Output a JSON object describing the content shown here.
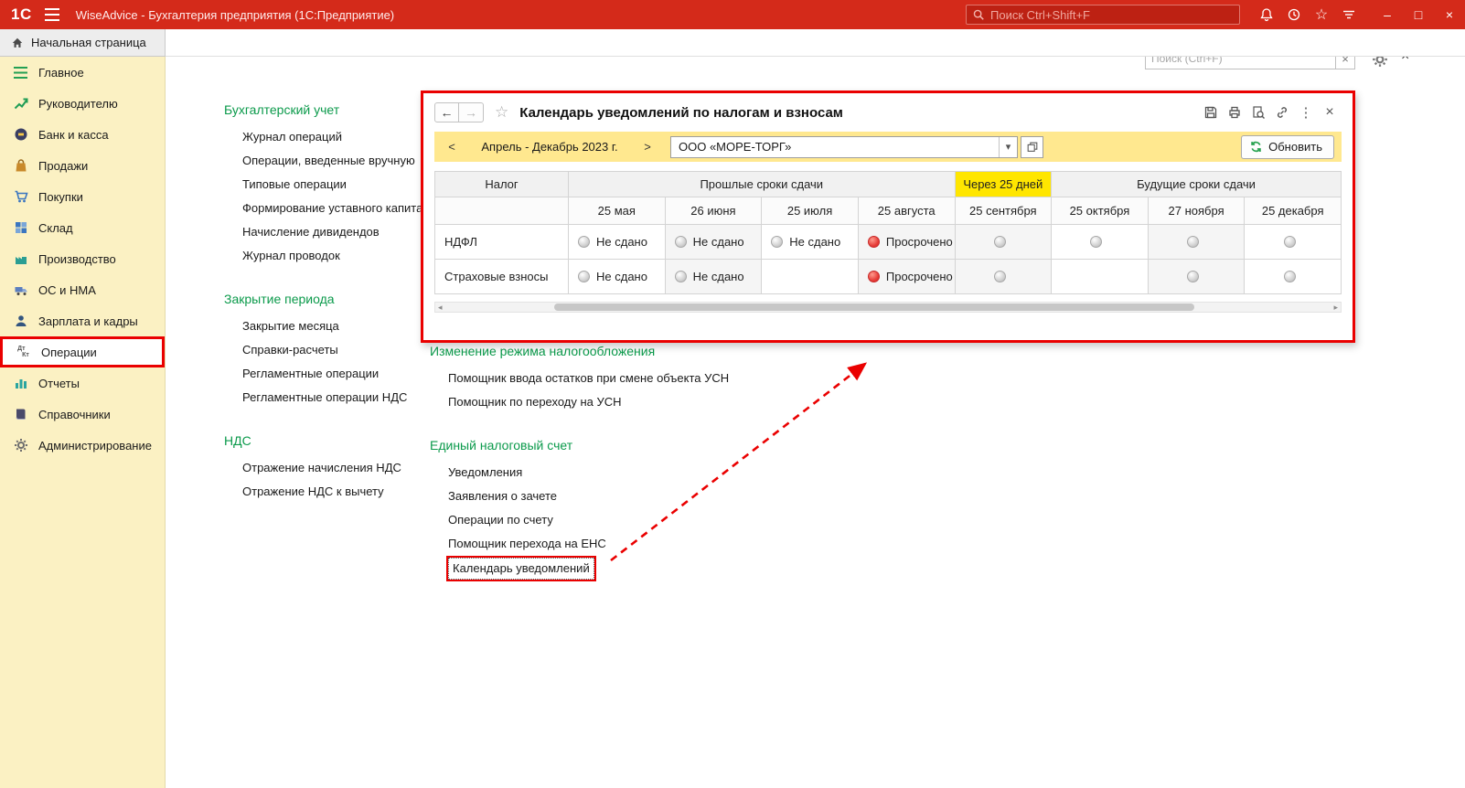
{
  "colors": {
    "brand_red": "#d42a1a",
    "sidebar_yellow": "#fbf1c3",
    "accent_green": "#0b9a4b",
    "toolbar_yellow": "#ffe88f",
    "highlight_yellow": "#ffe600",
    "overdue_red": "#e53935",
    "pending_gray": "#c4c4c4",
    "annotation_red": "#ea0000"
  },
  "icons": {
    "back": "←",
    "forward": "→",
    "star": "☆",
    "kebab": "⋮",
    "close": "×",
    "minimize": "–",
    "maximize": "□",
    "clear": "×",
    "prev": "<",
    "next": ">",
    "dropdown": "▾",
    "scroll_left": "◂",
    "scroll_right": "▸"
  },
  "titlebar": {
    "logo": "1С",
    "title": "WiseAdvice - Бухгалтерия предприятия  (1С:Предприятие)",
    "search_placeholder": "Поиск Ctrl+Shift+F"
  },
  "tabbar": {
    "home_tab": "Начальная страница"
  },
  "sidebar": {
    "items": [
      "Главное",
      "Руководителю",
      "Банк и касса",
      "Продажи",
      "Покупки",
      "Склад",
      "Производство",
      "ОС и НМА",
      "Зарплата и кадры",
      "Операции",
      "Отчеты",
      "Справочники",
      "Администрирование"
    ]
  },
  "workspace": {
    "search_placeholder": "Поиск (Ctrl+F)"
  },
  "menu": {
    "groups": [
      {
        "title": "Бухгалтерский учет",
        "items": [
          "Журнал операций",
          "Операции, введенные вручную",
          "Типовые операции",
          "Формирование уставного капитала",
          "Начисление дивидендов",
          "Журнал проводок"
        ]
      },
      {
        "title": "Закрытие периода",
        "items": [
          "Закрытие месяца",
          "Справки-расчеты",
          "Регламентные операции",
          "Регламентные операции НДС"
        ]
      },
      {
        "title": "НДС",
        "items": [
          "Отражение начисления НДС",
          "Отражение НДС к вычету"
        ]
      },
      {
        "title": "Изменение режима налогообложения",
        "items": [
          "Помощник ввода остатков при смене объекта УСН",
          "Помощник по переходу на УСН"
        ]
      },
      {
        "title": "Единый налоговый счет",
        "items": [
          "Уведомления",
          "Заявления о зачете",
          "Операции по счету",
          "Помощник перехода на ЕНС",
          "Календарь уведомлений"
        ]
      }
    ]
  },
  "window": {
    "title": "Календарь уведомлений по налогам и взносам",
    "period": "Апрель - Декабрь 2023 г.",
    "organization": "ООО «МОРЕ-ТОРГ»",
    "refresh_label": "Обновить",
    "table": {
      "tax_header": "Налог",
      "past_header": "Прошлые сроки сдачи",
      "soon_header": "Через 25 дней",
      "future_header": "Будущие сроки сдачи",
      "dates": [
        "25 мая",
        "26 июня",
        "25 июля",
        "25 августа",
        "25 сентября",
        "25 октября",
        "27 ноября",
        "25 декабря"
      ],
      "rows": [
        {
          "tax": "НДФЛ",
          "cells": [
            {
              "status": "pending",
              "label": "Не сдано"
            },
            {
              "status": "pending",
              "label": "Не сдано"
            },
            {
              "status": "pending",
              "label": "Не сдано"
            },
            {
              "status": "overdue",
              "label": "Просрочено"
            },
            {
              "status": "future",
              "label": ""
            },
            {
              "status": "future",
              "label": ""
            },
            {
              "status": "future",
              "label": ""
            },
            {
              "status": "future",
              "label": ""
            }
          ]
        },
        {
          "tax": "Страховые взносы",
          "cells": [
            {
              "status": "pending",
              "label": "Не сдано"
            },
            {
              "status": "pending",
              "label": "Не сдано"
            },
            {
              "status": "empty",
              "label": ""
            },
            {
              "status": "overdue",
              "label": "Просрочено"
            },
            {
              "status": "future",
              "label": ""
            },
            {
              "status": "empty",
              "label": ""
            },
            {
              "status": "future",
              "label": ""
            },
            {
              "status": "future",
              "label": ""
            }
          ]
        }
      ]
    }
  }
}
